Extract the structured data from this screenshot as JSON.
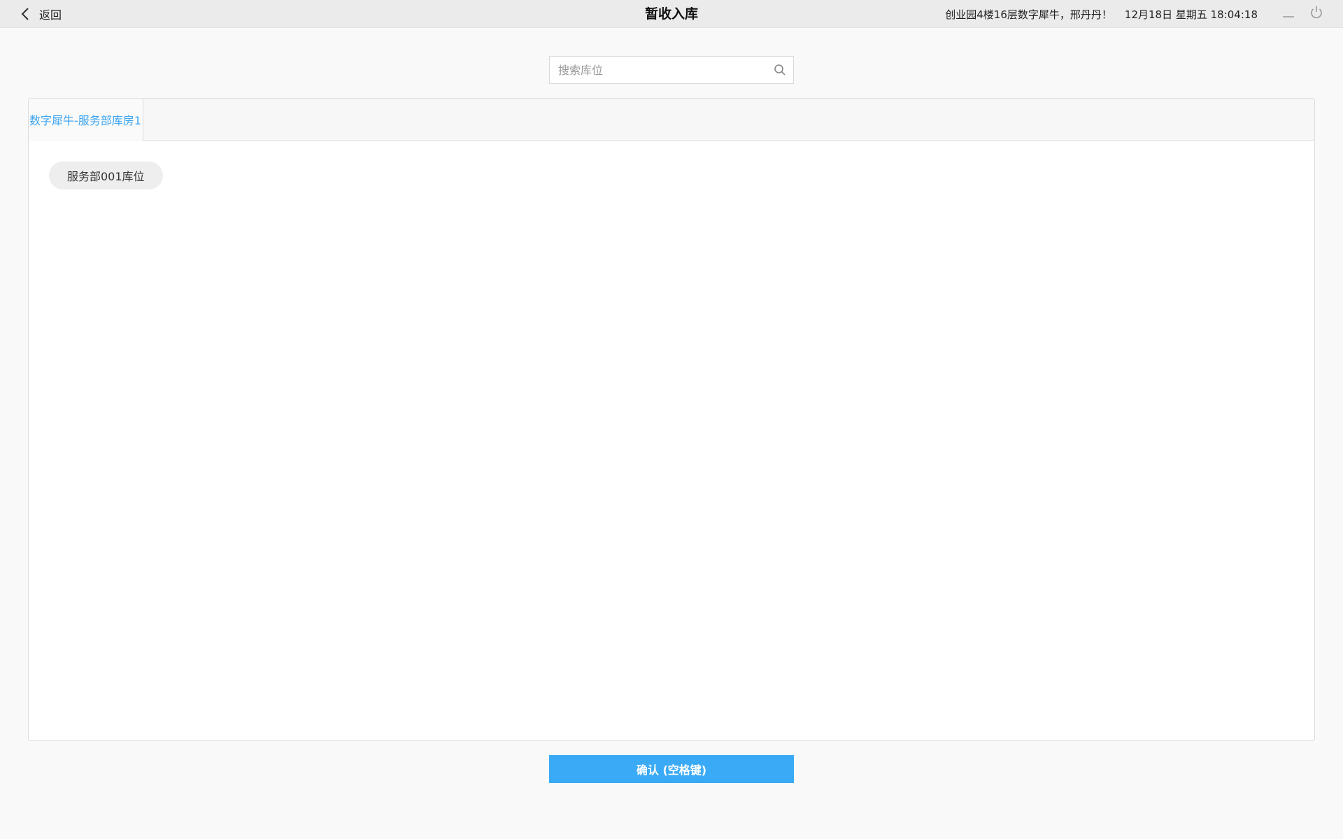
{
  "header": {
    "back_label": "返回",
    "title": "暂收入库",
    "greeting": "创业园4楼16层数字犀牛，邢丹丹！",
    "datetime": "12月18日 星期五 18:04:18",
    "icons": [
      "chevron-left-icon",
      "minimize-icon",
      "power-icon"
    ]
  },
  "search": {
    "placeholder": "搜索库位",
    "value": "",
    "icon": "search-icon"
  },
  "tabs": [
    {
      "label": "数字犀牛-服务部库房1",
      "active": true
    }
  ],
  "slots": [
    {
      "label": "服务部001库位"
    }
  ],
  "confirm_label": "确认 (空格键)",
  "colors": {
    "accent": "#3aaaf6",
    "tab_active_text": "#3aa4f0",
    "titlebar_bg": "#ebebeb",
    "page_bg": "#f9f9f9"
  }
}
